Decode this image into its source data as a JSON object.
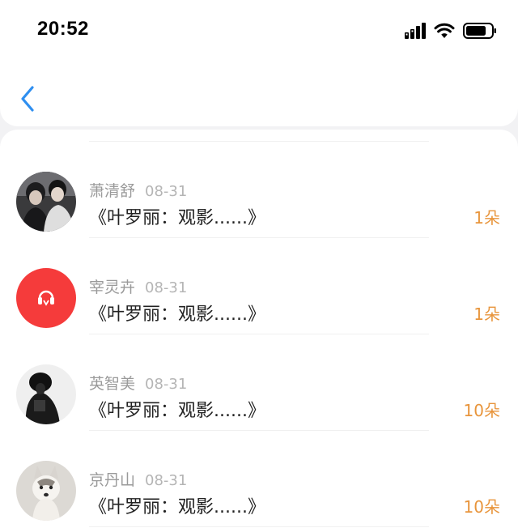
{
  "status_bar": {
    "time": "20:52",
    "signal_icon": "signal-icon",
    "wifi_icon": "wifi-icon",
    "battery_icon": "battery-icon"
  },
  "nav": {
    "back_icon": "chevron-left-icon",
    "accent": "#2f8ff0"
  },
  "items": [
    {
      "name": "萧清舒",
      "date": "08-31",
      "title": "《叶罗丽：观影......》",
      "count": "1朵"
    },
    {
      "name": "宰灵卉",
      "date": "08-31",
      "title": "《叶罗丽：观影......》",
      "count": "1朵"
    },
    {
      "name": "英智美",
      "date": "08-31",
      "title": "《叶罗丽：观影......》",
      "count": "10朵"
    },
    {
      "name": "京丹山",
      "date": "08-31",
      "title": "《叶罗丽：观影......》",
      "count": "10朵"
    }
  ],
  "colors": {
    "count": "#e8953c",
    "avatar_red": "#f53b3b"
  }
}
